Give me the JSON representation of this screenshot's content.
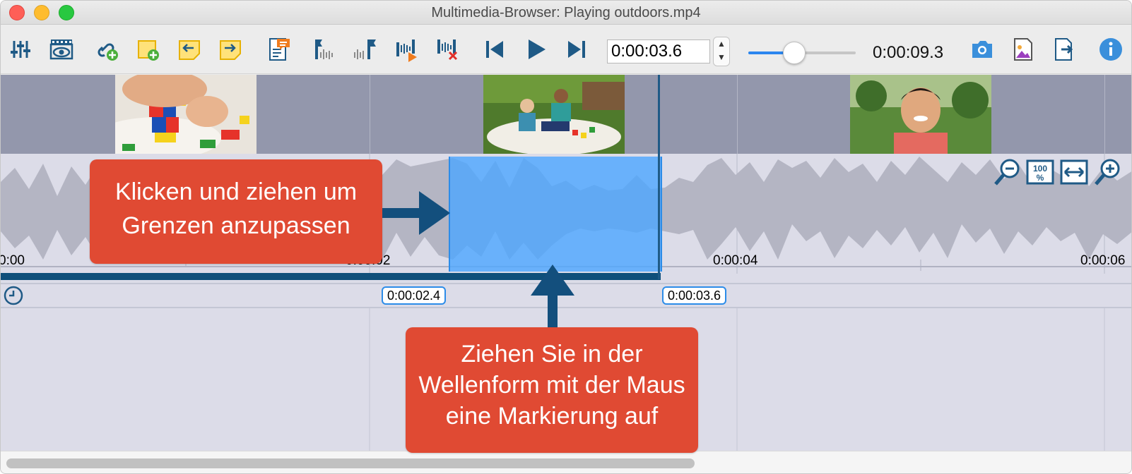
{
  "window": {
    "title": "Multimedia-Browser:  Playing outdoors.mp4"
  },
  "toolbar": {
    "icons": [
      "settings-sliders-icon",
      "video-view-icon",
      "add-link-icon",
      "add-note-icon",
      "note-left-icon",
      "note-right-icon",
      "comment-icon",
      "set-start-marker-icon",
      "set-end-marker-icon",
      "play-selection-icon",
      "delete-selection-icon",
      "skip-back-icon",
      "play-icon",
      "skip-forward-icon"
    ],
    "current_time": "0:00:03.6",
    "volume_level": 0.43,
    "duration": "0:00:09.3",
    "right_icons": [
      "camera-icon",
      "image-export-icon",
      "document-export-icon",
      "info-icon"
    ]
  },
  "colors": {
    "accent": "#2b86ef",
    "callout": "#e04a33",
    "selection": "#4ca6ff",
    "timebar": "#0f4f7a",
    "info": "#3a8fdb"
  },
  "waveform": {
    "tick_labels": [
      "0:00",
      "0:00:02",
      "0:00:04",
      "0:00:06"
    ],
    "zoom_icons": [
      "zoom-out-icon",
      "zoom-100-icon",
      "fit-width-icon",
      "zoom-in-icon"
    ]
  },
  "markers": {
    "start": "0:00:02.4",
    "end": "0:00:03.6"
  },
  "callouts": {
    "top": [
      "Klicken und ziehen um",
      "Grenzen anzupassen"
    ],
    "bottom": [
      "Ziehen Sie in der",
      "Wellenform mit der Maus",
      "eine Markierung auf"
    ]
  }
}
